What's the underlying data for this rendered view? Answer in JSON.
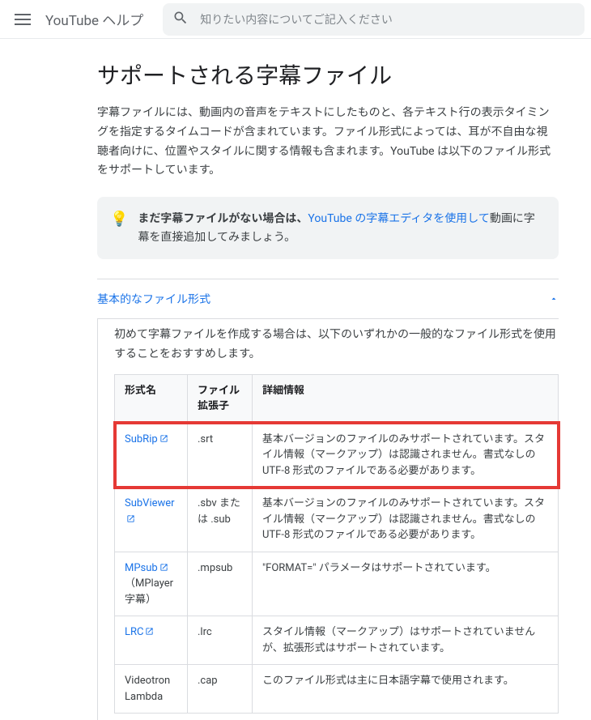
{
  "header": {
    "brand": "YouTube ヘルプ",
    "search_placeholder": "知りたい内容についてご記入ください"
  },
  "page": {
    "title": "サポートされる字幕ファイル",
    "intro": "字幕ファイルには、動画内の音声をテキストにしたものと、各テキスト行の表示タイミングを指定するタイムコードが含まれています。ファイル形式によっては、耳が不自由な視聴者向けに、位置やスタイルに関する情報も含まれます。YouTube は以下のファイル形式をサポートしています。"
  },
  "tip": {
    "bold": "まだ字幕ファイルがない場合は、",
    "link": "YouTube の字幕エディタを使用して",
    "rest": "動画に字幕を直接追加してみましょう。"
  },
  "accordion": {
    "title": "基本的なファイル形式",
    "intro": "初めて字幕ファイルを作成する場合は、以下のいずれかの一般的なファイル形式を使用することをおすすめします。"
  },
  "table": {
    "headers": {
      "name": "形式名",
      "ext": "ファイル拡張子",
      "desc": "詳細情報"
    },
    "rows": [
      {
        "link": true,
        "name": "SubRip",
        "ext": ".srt",
        "desc": "基本バージョンのファイルのみサポートされています。スタイル情報（マークアップ）は認識されません。書式なしの UTF-8 形式のファイルである必要があります。",
        "highlight": true
      },
      {
        "link": true,
        "name": "SubViewer",
        "ext": ".sbv または .sub",
        "desc": "基本バージョンのファイルのみサポートされています。スタイル情報（マークアップ）は認識されません。書式なしの UTF-8 形式のファイルである必要があります。"
      },
      {
        "link": true,
        "name": "MPsub",
        "name_suffix": "（MPlayer 字幕）",
        "ext": ".mpsub",
        "desc": "\"FORMAT=\" パラメータはサポートされています。"
      },
      {
        "link": true,
        "name": "LRC",
        "ext": ".lrc",
        "desc": "スタイル情報（マークアップ）はサポートされていませんが、拡張形式はサポートされています。"
      },
      {
        "link": false,
        "name": "Videotron Lambda",
        "ext": ".cap",
        "desc": "このファイル形式は主に日本語字幕で使用されます。"
      }
    ]
  }
}
